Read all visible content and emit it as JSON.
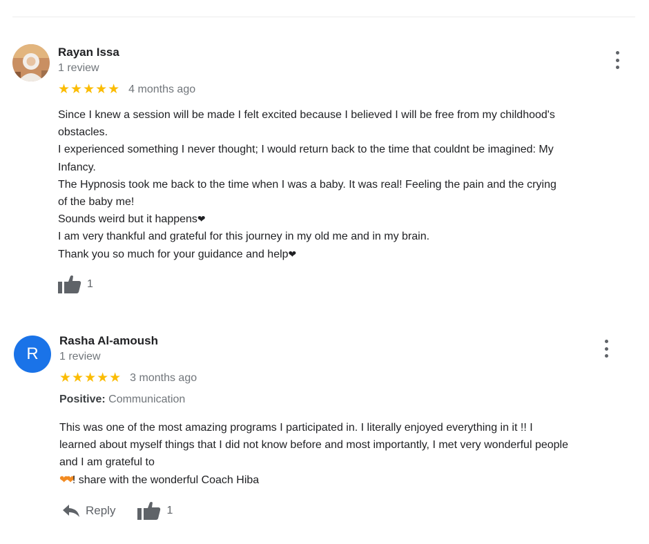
{
  "reviews": [
    {
      "author": "Rayan Issa",
      "review_count": "1 review",
      "stars": "★★★★★",
      "time": "4 months ago",
      "lines": [
        "Since I knew a session will be made I felt excited because I believed I will be free from my childhood's",
        "obstacles.",
        "I experienced something I never thought; I would return back to the time that couldnt be imagined: My",
        "Infancy.",
        "The Hypnosis took me back to the time when I  was a baby. It was real! Feeling the pain and the crying",
        "of the baby me!",
        "Sounds weird but it happens",
        "I am very thankful and grateful for this journey in my old me and in my brain.",
        "Thank you so much for your guidance and help"
      ],
      "heart": "❤",
      "likes": "1"
    },
    {
      "author": "Rasha Al-amoush",
      "avatar_letter": "R",
      "review_count": "1 review",
      "stars": "★★★★★",
      "time": "3 months ago",
      "positive_label": "Positive:",
      "positive_value": "Communication",
      "lines": [
        "This was one of the most amazing programs I participated in. I literally enjoyed everything in it !!  I",
        "learned about myself things that I did not know before and most importantly, I met very wonderful people",
        "and I am grateful to",
        "! share with the wonderful Coach Hiba"
      ],
      "orange_hearts": "❤❤",
      "reply_label": "Reply",
      "likes": "1"
    }
  ],
  "colors": {
    "star": "#fbbc04",
    "avatar_blue": "#1a73e8",
    "muted_text": "#70757a",
    "icon_gray": "#5f6368"
  },
  "icons": {
    "more": "more-vert-icon",
    "like": "thumb-up-icon",
    "reply": "reply-arrow-icon"
  }
}
